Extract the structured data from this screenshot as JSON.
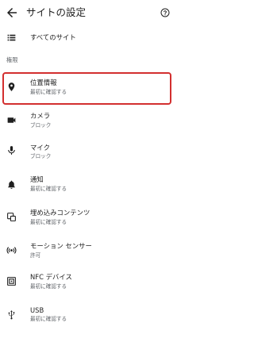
{
  "appbar": {
    "title": "サイトの設定",
    "back_icon": "arrow-back-icon",
    "help_icon": "help-icon"
  },
  "all_sites": {
    "label": "すべてのサイト",
    "icon": "list-icon"
  },
  "section": {
    "header": "権限"
  },
  "permissions": [
    {
      "label": "位置情報",
      "status": "最初に確認する",
      "icon": "location-pin-icon",
      "highlighted": true
    },
    {
      "label": "カメラ",
      "status": "ブロック",
      "icon": "camera-icon"
    },
    {
      "label": "マイク",
      "status": "ブロック",
      "icon": "microphone-icon"
    },
    {
      "label": "通知",
      "status": "最初に確認する",
      "icon": "bell-icon"
    },
    {
      "label": "埋め込みコンテンツ",
      "status": "最初に確認する",
      "icon": "embedded-content-icon"
    },
    {
      "label": "モーション センサー",
      "status": "許可",
      "icon": "motion-sensor-icon"
    },
    {
      "label": "NFC デバイス",
      "status": "最初に確認する",
      "icon": "nfc-icon"
    },
    {
      "label": "USB",
      "status": "最初に確認する",
      "icon": "usb-icon"
    }
  ],
  "colors": {
    "highlight": "#d32f2f",
    "text_primary": "#1f1f1f",
    "text_secondary": "#5f6368"
  }
}
